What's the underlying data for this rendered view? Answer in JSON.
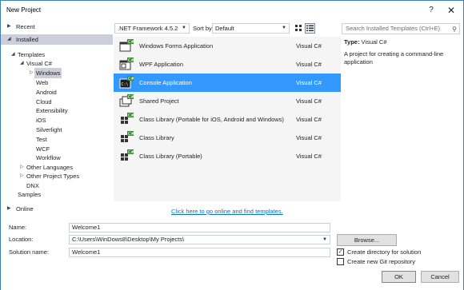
{
  "window": {
    "title": "New Project",
    "help_glyph": "?",
    "close_glyph": "✕"
  },
  "nav": {
    "recent": "Recent",
    "installed": "Installed",
    "templates": "Templates",
    "visual_csharp": "Visual C#",
    "windows": "Windows",
    "web": "Web",
    "android": "Android",
    "cloud": "Cloud",
    "extensibility": "Extensibility",
    "ios": "iOS",
    "silverlight": "Silverlight",
    "test": "Test",
    "wcf": "WCF",
    "workflow": "Workflow",
    "other_languages": "Other Languages",
    "other_project_types": "Other Project Types",
    "dnx": "DNX",
    "samples": "Samples",
    "online": "Online"
  },
  "toolbar": {
    "framework": ".NET Framework 4.5.2",
    "sort_label": "Sort by:",
    "sort_value": "Default",
    "search_placeholder": "Search Installed Templates (Ctrl+E)"
  },
  "templates": [
    {
      "name": "Windows Forms Application",
      "lang": "Visual C#",
      "icon": "winforms-icon",
      "selected": false
    },
    {
      "name": "WPF Application",
      "lang": "Visual C#",
      "icon": "wpf-icon",
      "selected": false
    },
    {
      "name": "Console Application",
      "lang": "Visual C#",
      "icon": "console-icon",
      "selected": true
    },
    {
      "name": "Shared Project",
      "lang": "Visual C#",
      "icon": "shared-project-icon",
      "selected": false
    },
    {
      "name": "Class Library (Portable for iOS, Android and Windows)",
      "lang": "Visual C#",
      "icon": "class-library-icon",
      "selected": false
    },
    {
      "name": "Class Library",
      "lang": "Visual C#",
      "icon": "class-library-icon",
      "selected": false
    },
    {
      "name": "Class Library (Portable)",
      "lang": "Visual C#",
      "icon": "class-library-icon",
      "selected": false
    }
  ],
  "online_link": "Click here to go online and find templates.",
  "info": {
    "type_label": "Type:",
    "type_value": "Visual C#",
    "description": "A project for creating a command-line application"
  },
  "form": {
    "name_label": "Name:",
    "name_value": "Welcome1",
    "location_label": "Location:",
    "location_value": "C:\\Users\\WinDows8\\Desktop\\My Projects\\",
    "solution_label": "Solution name:",
    "solution_value": "Welcome1",
    "browse_label": "Browse...",
    "create_dir_label": "Create directory for solution",
    "create_dir_checked": true,
    "git_label": "Create new Git repository",
    "git_checked": false,
    "ok_label": "OK",
    "cancel_label": "Cancel"
  },
  "colors": {
    "accent": "#3399ff",
    "selected_nav": "#cccedb",
    "link": "#0e70c0",
    "list_bg": "#f5f5f5",
    "icon_green": "#388a34"
  }
}
